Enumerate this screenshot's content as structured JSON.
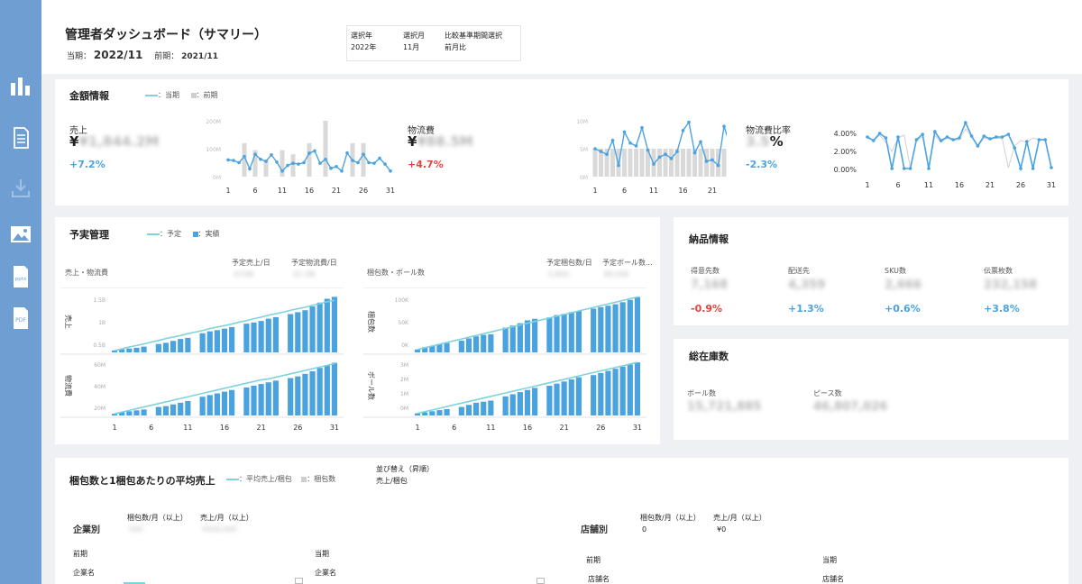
{
  "header": {
    "title": "管理者ダッシュボード（サマリー）",
    "current_label": "当期：",
    "current_value": "2022/11",
    "previous_label": "前期：",
    "previous_value": "2021/11"
  },
  "filters": [
    {
      "label": "選択年",
      "value": "2022年"
    },
    {
      "label": "選択月",
      "value": "11月"
    },
    {
      "label": "比較基準期間選択",
      "value": "前月比"
    }
  ],
  "sidebar": {
    "items": [
      {
        "icon": "bar-chart-icon"
      },
      {
        "icon": "document-icon"
      },
      {
        "icon": "download-icon"
      },
      {
        "icon": "image-icon"
      },
      {
        "icon": "pptx-icon",
        "text": "pptx"
      },
      {
        "icon": "pdf-icon",
        "text": "PDF"
      }
    ]
  },
  "amount": {
    "title": "金額情報",
    "legend_current": "：当期",
    "legend_previous": "：前期",
    "kpis": [
      {
        "label": "売上",
        "value": "¥1,844.2M",
        "change": "+7.2%"
      },
      {
        "label": "物流費",
        "value": "¥88.5M",
        "change": "+4.7%"
      },
      {
        "label": "物流費比率",
        "value": "3.5",
        "unit": "%",
        "change": "-2.3%"
      }
    ],
    "mini_axis": {
      "sales_ticks": [
        "200M",
        "100M",
        "0M"
      ],
      "cost_ticks": [
        "10M",
        "5M",
        "0M"
      ],
      "ratio_ticks": [
        "4.00%",
        "2.00%",
        "0.00%"
      ],
      "x_ticks": [
        "1",
        "6",
        "11",
        "16",
        "21",
        "26",
        "31"
      ]
    }
  },
  "chart_data": [
    {
      "type": "bar",
      "title": "売上",
      "x": [
        1,
        2,
        3,
        4,
        5,
        6,
        7,
        8,
        9,
        10,
        11,
        12,
        13,
        14,
        15,
        16,
        17,
        18,
        19,
        20,
        21,
        22,
        23,
        24,
        25,
        26,
        27,
        28,
        29,
        30,
        31
      ],
      "series": [
        {
          "name": "当期",
          "type": "line",
          "values": [
            60,
            58,
            50,
            72,
            28,
            80,
            62,
            55,
            78,
            52,
            20,
            40,
            48,
            45,
            50,
            84,
            92,
            48,
            62,
            30,
            36,
            20,
            85,
            58,
            50,
            80,
            50,
            48,
            66,
            45,
            20
          ]
        },
        {
          "name": "前期",
          "type": "bar",
          "values": [
            0,
            0,
            0,
            120,
            0,
            95,
            0,
            60,
            0,
            0,
            95,
            0,
            80,
            0,
            0,
            120,
            0,
            0,
            200,
            0,
            0,
            0,
            0,
            120,
            0,
            120,
            0,
            0,
            0,
            0,
            0
          ]
        }
      ]
    },
    {
      "type": "bar",
      "title": "物流費",
      "x": [
        1,
        2,
        3,
        4,
        5,
        6,
        7,
        8,
        9,
        10,
        11,
        12,
        13,
        14,
        15,
        16,
        17,
        18,
        19,
        20,
        21,
        22,
        23,
        24,
        25,
        26,
        27,
        28,
        29,
        30,
        31
      ],
      "series": [
        {
          "name": "当期",
          "type": "line",
          "values": [
            2,
            1.8,
            1.6,
            2.6,
            0.8,
            3.2,
            2.4,
            2.2,
            3.5,
            1.9,
            0.9,
            1.4,
            1.6,
            1.3,
            1.8,
            3.3,
            3.9,
            1.7,
            2.5,
            1.1,
            1.2,
            0.8,
            3.6,
            2.3,
            1.7,
            3.3,
            2.4,
            1.9,
            2.6,
            1.6,
            0.9
          ]
        },
        {
          "name": "前期",
          "type": "bar",
          "values": [
            2,
            2,
            2,
            2,
            2,
            2,
            2,
            2,
            2,
            2,
            2,
            2,
            2,
            2,
            2,
            2,
            2,
            2,
            2,
            2,
            2,
            2,
            2,
            2,
            2,
            2,
            2,
            2,
            2,
            2,
            2
          ]
        }
      ]
    },
    {
      "type": "line",
      "title": "物流費比率",
      "x": [
        1,
        2,
        3,
        4,
        5,
        6,
        7,
        8,
        9,
        10,
        11,
        12,
        13,
        14,
        15,
        16,
        17,
        18,
        19,
        20,
        21,
        22,
        23,
        24,
        25,
        26,
        27,
        28,
        29,
        30,
        31
      ],
      "series": [
        {
          "name": "当期",
          "values": [
            3.6,
            3.2,
            4.0,
            3.5,
            0.1,
            3.6,
            0.1,
            0.1,
            3.3,
            3.9,
            0.1,
            4.2,
            3.2,
            3.6,
            3.3,
            3.5,
            5.2,
            3.7,
            2.6,
            3.7,
            3.4,
            3.6,
            3.6,
            3.9,
            2.4,
            0.1,
            3.1,
            0.1,
            3.3,
            3.3,
            0.2
          ]
        },
        {
          "name": "前期",
          "values": [
            3.5,
            3.2,
            3.8,
            3.0,
            2.0,
            3.5,
            3.8,
            0.2,
            3.2,
            3.6,
            0.2,
            3.8,
            3.0,
            3.5,
            3.2,
            3.3,
            4.5,
            3.6,
            2.5,
            3.5,
            3.3,
            3.5,
            3.4,
            0.2,
            2.6,
            3.2,
            3.0,
            3.5,
            3.3,
            3.2,
            0.2
          ]
        }
      ]
    },
    {
      "type": "bar",
      "title": "売上・物流費",
      "x": [
        1,
        2,
        3,
        4,
        5,
        6,
        7,
        8,
        9,
        10,
        11,
        12,
        13,
        14,
        15,
        16,
        17,
        18,
        19,
        20,
        21,
        22,
        23,
        24,
        25,
        26,
        27,
        28,
        29,
        30,
        31
      ],
      "series": [
        {
          "name": "実績 売上",
          "values": [
            0.05,
            0.08,
            0.1,
            0.12,
            0.15,
            0,
            0.22,
            0.25,
            0.3,
            0.35,
            0.38,
            0,
            0.5,
            0.55,
            0.58,
            0.62,
            0.66,
            0,
            0.75,
            0.78,
            0.82,
            0.88,
            0.92,
            0,
            1.0,
            1.05,
            1.1,
            1.2,
            1.3,
            1.4,
            1.45
          ]
        },
        {
          "name": "予定 売上",
          "values": [
            0.05,
            0.09,
            0.14,
            0.18,
            0.22,
            0.27,
            0.31,
            0.36,
            0.4,
            0.44,
            0.49,
            0.53,
            0.57,
            0.62,
            0.66,
            0.7,
            0.74,
            0.79,
            0.83,
            0.88,
            0.92,
            0.97,
            1.01,
            1.05,
            1.1,
            1.14,
            1.18,
            1.23,
            1.27,
            1.32,
            1.36
          ]
        },
        {
          "name": "実績 物流費",
          "values": [
            2,
            4,
            5,
            6,
            7,
            0,
            10,
            11,
            13,
            15,
            17,
            0,
            22,
            24,
            26,
            28,
            30,
            0,
            33,
            35,
            37,
            39,
            41,
            0,
            44,
            46,
            49,
            52,
            56,
            59,
            62
          ]
        },
        {
          "name": "予定 物流費",
          "values": [
            2,
            4,
            6,
            8,
            10,
            12,
            14,
            16,
            18,
            20,
            22,
            24,
            26,
            28,
            30,
            32,
            34,
            36,
            38,
            40,
            42,
            43,
            45,
            47,
            49,
            51,
            53,
            55,
            57,
            59,
            61
          ]
        }
      ],
      "y_ticks_sales": [
        "1.5B",
        "1B",
        "0.5B"
      ],
      "y_ticks_cost": [
        "60M",
        "40M",
        "20M"
      ]
    },
    {
      "type": "bar",
      "title": "梱包数・ボール数",
      "x": [
        1,
        2,
        3,
        4,
        5,
        6,
        7,
        8,
        9,
        10,
        11,
        12,
        13,
        14,
        15,
        16,
        17,
        18,
        19,
        20,
        21,
        22,
        23,
        24,
        25,
        26,
        27,
        28,
        29,
        30,
        31
      ],
      "series": [
        {
          "name": "実績 梱包数",
          "values": [
            10,
            18,
            22,
            28,
            32,
            0,
            40,
            48,
            55,
            60,
            62,
            0,
            85,
            92,
            100,
            110,
            115,
            0,
            120,
            128,
            132,
            138,
            142,
            0,
            150,
            155,
            160,
            165,
            172,
            180,
            190
          ]
        },
        {
          "name": "予定 梱包数",
          "values": [
            10,
            16,
            22,
            28,
            34,
            40,
            46,
            52,
            58,
            64,
            70,
            76,
            82,
            88,
            94,
            100,
            106,
            112,
            118,
            124,
            130,
            136,
            142,
            148,
            154,
            160,
            166,
            172,
            178,
            184,
            190
          ]
        },
        {
          "name": "実績 ボール数",
          "values": [
            1,
            1.5,
            2,
            2.5,
            3,
            0,
            4,
            5,
            6,
            6.5,
            7,
            0,
            9,
            10,
            11,
            12,
            13,
            0,
            14,
            15,
            16,
            17,
            18,
            0,
            19,
            20,
            21,
            22,
            23,
            24,
            25
          ]
        },
        {
          "name": "予定 ボール数",
          "values": [
            1,
            1.8,
            2.6,
            3.4,
            4.2,
            5,
            5.8,
            6.6,
            7.4,
            8.2,
            9,
            9.8,
            10.6,
            11.4,
            12.2,
            13,
            13.8,
            14.6,
            15.4,
            16.2,
            17,
            17.8,
            18.6,
            19.4,
            20.2,
            21,
            21.8,
            22.6,
            23.4,
            24.2,
            25
          ]
        }
      ],
      "y_ticks_pack": [
        "100K",
        "50K",
        "0K"
      ],
      "y_ticks_ball": [
        "3M",
        "2M",
        "1M",
        "0M"
      ]
    }
  ],
  "budget": {
    "title": "予実管理",
    "legend_plan": "：予定",
    "legend_actual": "：実績",
    "left": {
      "label": "売上・物流費",
      "plan_sales_label": "予定売上/日",
      "plan_sales_value": "475M",
      "plan_cost_label": "予定物流費/日",
      "plan_cost_value": "42.3M",
      "row1_label": "売上",
      "row2_label": "物流費"
    },
    "right": {
      "label": "梱包数・ボール数",
      "plan_pack_label": "予定梱包数/日",
      "plan_pack_value": "5,800",
      "plan_ball_label": "予定ボール数...",
      "plan_ball_value": "80,000",
      "row1_label": "梱包数",
      "row2_label": "ボール数"
    },
    "x_ticks": [
      "1",
      "6",
      "11",
      "16",
      "21",
      "26",
      "31"
    ]
  },
  "delivery": {
    "title": "納品情報",
    "items": [
      {
        "label": "得意先数",
        "value": "7,168",
        "change": "-0.9%"
      },
      {
        "label": "配送先",
        "value": "4,359",
        "change": "+1.3%"
      },
      {
        "label": "SKU数",
        "value": "2,666",
        "change": "+0.6%"
      },
      {
        "label": "伝票枚数",
        "value": "232,158",
        "change": "+3.8%"
      }
    ]
  },
  "inventory": {
    "title": "総在庫数",
    "items": [
      {
        "label": "ボール数",
        "value": "15,721,885"
      },
      {
        "label": "ピース数",
        "value": "46,807,026"
      }
    ]
  },
  "packing": {
    "title": "梱包数と1梱包あたりの平均売上",
    "legend_avg": "：平均売上/梱包",
    "legend_pack": "：梱包数",
    "sort_label": "並び替え（昇順）",
    "sort_value": "売上/梱包",
    "company": {
      "title": "企業別",
      "filter1_label": "梱包数/月（以上）",
      "filter1_value": "500",
      "filter2_label": "売上/月（以上）",
      "filter2_value": "¥500,000",
      "prev": "前期",
      "curr": "当期",
      "col": "企業名"
    },
    "store": {
      "title": "店舗別",
      "filter1_label": "梱包数/月（以上）",
      "filter1_value": "0",
      "filter2_label": "売上/月（以上）",
      "filter2_value": "¥0",
      "prev": "前期",
      "curr": "当期",
      "col": "店舗名"
    }
  }
}
